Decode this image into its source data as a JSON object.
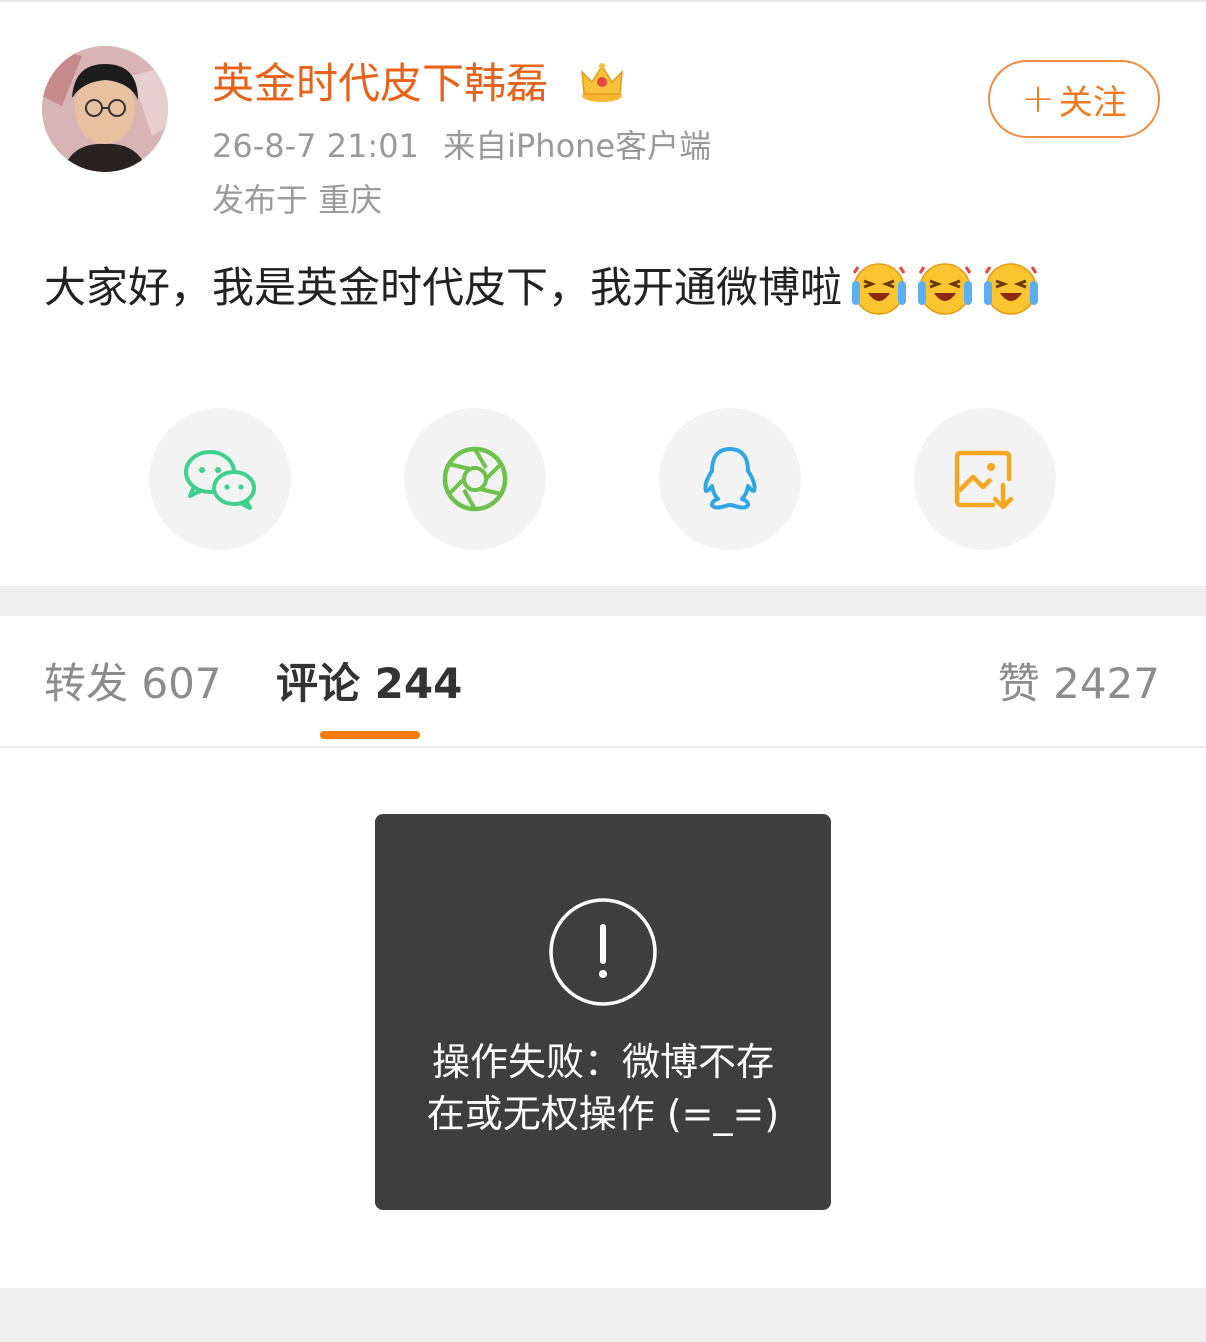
{
  "post": {
    "username": "英金时代皮下韩磊",
    "badge_icon": "crown-icon",
    "timestamp": "26-8-7 21:01",
    "source": "来自iPhone客户端",
    "location": "发布于 重庆",
    "follow_label": "关注",
    "follow_plus": "+",
    "text": "大家好，我是英金时代皮下，我开通微博啦",
    "emoji_icon": "laughing-crying-emoji-icon",
    "emoji_count": 3
  },
  "share": {
    "items": [
      {
        "icon": "wechat-icon",
        "color": "#3fcf8e"
      },
      {
        "icon": "moments-icon",
        "color": "#6cc24a"
      },
      {
        "icon": "qq-icon",
        "color": "#2fa7e6"
      },
      {
        "icon": "save-image-icon",
        "color": "#f5a623"
      }
    ]
  },
  "tabs": {
    "repost": "转发 607",
    "comments": "评论 244",
    "likes": "赞 2427",
    "active": "comments",
    "accent_color": "#ff7a00"
  },
  "toast": {
    "icon": "exclamation-icon",
    "line1": "操作失败：微博不存",
    "line2": "在或无权操作 (=_=)"
  },
  "colors": {
    "username": "#e8631a",
    "meta": "#9a9a9a",
    "follow": "#f07a20"
  }
}
